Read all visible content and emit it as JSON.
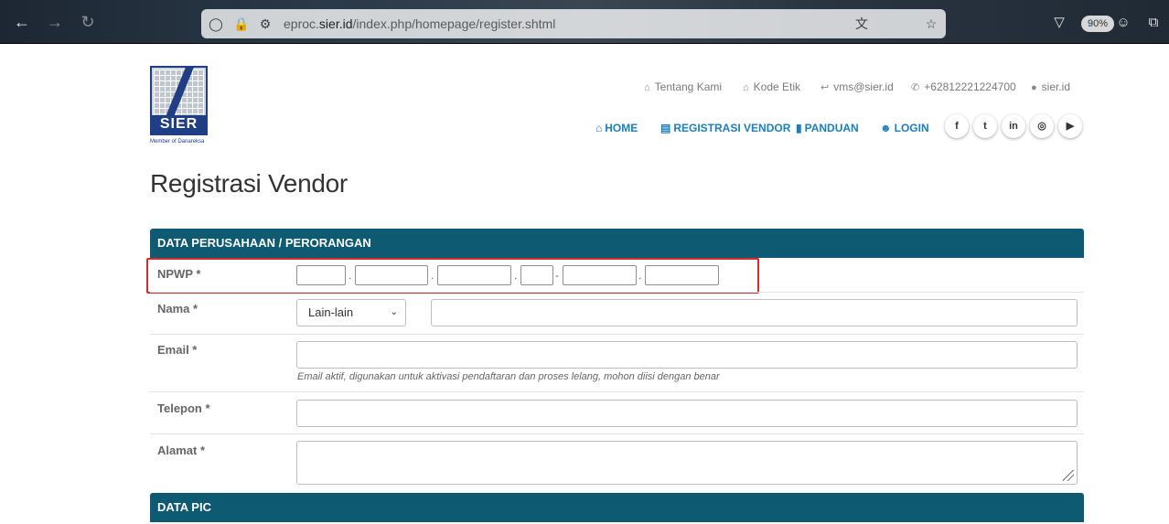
{
  "browser": {
    "url_prefix": "eproc.",
    "url_domain": "sier.id",
    "url_path": "/index.php/homepage/register.shtml",
    "zoom": "90%"
  },
  "logo": {
    "brand": "SIER",
    "member_text": "Member of Danareksa"
  },
  "topinfo": {
    "about": "Tentang Kami",
    "ethics": "Kode Etik",
    "email": "vms@sier.id",
    "phone": "+62812221224700",
    "site": "sier.id"
  },
  "nav": {
    "home": "HOME",
    "register": "REGISTRASI VENDOR",
    "guide": "PANDUAN",
    "login": "LOGIN"
  },
  "social": {
    "facebook": "f",
    "twitter": "t",
    "linkedin": "in",
    "instagram": "◎",
    "youtube": "▶"
  },
  "page": {
    "title": "Registrasi Vendor"
  },
  "form": {
    "section1": "DATA PERUSAHAAN / PERORANGAN",
    "npwp_label": "NPWP *",
    "npwp_separators": [
      ".",
      ".",
      ".",
      "-",
      "."
    ],
    "nama_label": "Nama *",
    "nama_select": "Lain-lain",
    "email_label": "Email *",
    "email_help": "Email aktif, digunakan untuk aktivasi pendaftaran dan proses lelang, mohon diisi dengan benar",
    "telepon_label": "Telepon *",
    "alamat_label": "Alamat *",
    "section2": "DATA PIC"
  },
  "colors": {
    "section_header": "#0e5a72",
    "nav_link": "#1a7fbf",
    "highlight": "#d92b2b",
    "logo": "#1f3e86"
  }
}
